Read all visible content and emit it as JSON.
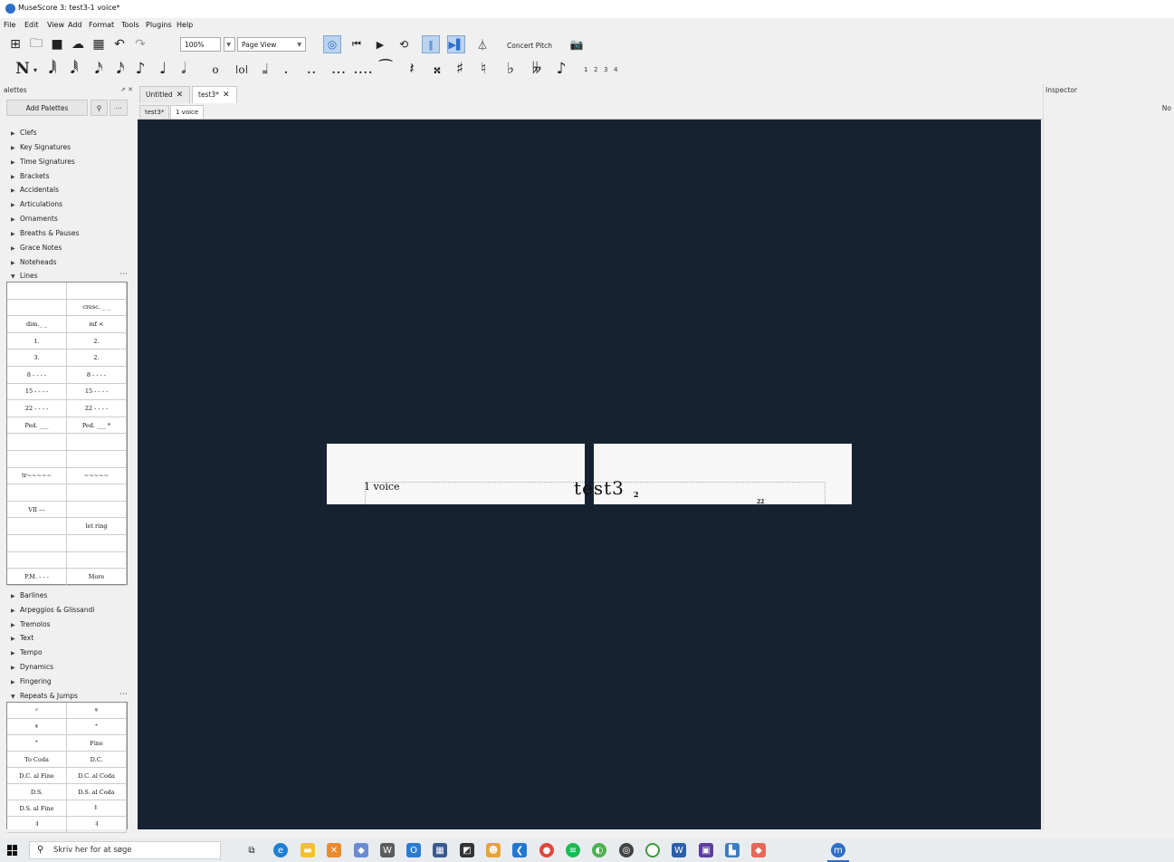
{
  "window": {
    "title": "MuseScore 3: test3-1 voice*"
  },
  "menu": [
    "File",
    "Edit",
    "View",
    "Add",
    "Format",
    "Tools",
    "Plugins",
    "Help"
  ],
  "toolbar": {
    "zoom": "100%",
    "view_mode": "Page View",
    "concert_pitch": "Concert Pitch"
  },
  "note_toolbar": {
    "voices": [
      "1",
      "2",
      "3",
      "4"
    ]
  },
  "palettes": {
    "title": "alettes",
    "add_label": "Add Palettes",
    "categories_top": [
      "Clefs",
      "Key Signatures",
      "Time Signatures",
      "Brackets",
      "Accidentals",
      "Articulations",
      "Ornaments",
      "Breaths & Pauses",
      "Grace Notes",
      "Noteheads"
    ],
    "lines_label": "Lines",
    "lines_cells": [
      "",
      "",
      "",
      "cresc. _ _",
      "dim._ _",
      "mf <",
      "1.",
      "2.",
      "3.",
      "2.",
      "8 - - - -",
      "8 - - - -",
      "15 - - - -",
      "15 - - - -",
      "22 - - - -",
      "22 - - - -",
      "Ped. ___",
      "Ped. ___ *",
      "",
      "",
      "",
      "",
      "tr~~~~~",
      "~~~~~",
      "",
      "",
      "VII ---",
      "",
      "",
      "let ring",
      "",
      "",
      "",
      "",
      "P.M. - - -",
      "More"
    ],
    "categories_mid": [
      "Barlines",
      "Arpeggios & Glissandi",
      "Tremolos",
      "Text",
      "Tempo",
      "Dynamics",
      "Fingering"
    ],
    "repeats_label": "Repeats & Jumps",
    "repeats_cells": [
      "𝄎",
      "𝄋",
      "𝄋",
      "𝄌",
      "𝄌",
      "Fine",
      "To Coda",
      "D.C.",
      "D.C. al Fine",
      "D.C. al Coda",
      "D.S.",
      "D.S. al Coda",
      "D.S. al Fine",
      "𝄆",
      "𝄇",
      "𝄇"
    ]
  },
  "tabs": [
    {
      "label": "Untitled",
      "close": "✕"
    },
    {
      "label": "test3*",
      "close": "✕"
    }
  ],
  "subtabs": [
    "test3*",
    "1 voice"
  ],
  "score": {
    "part_label": "1 voice",
    "title": "test3",
    "superscript": "2",
    "bottom_mark": "22"
  },
  "inspector": {
    "title": "Inspector",
    "no_selection": "No"
  },
  "taskbar": {
    "search_placeholder": "Skriv her for at søge"
  },
  "colors": {
    "canvas": "#162231",
    "accent": "#2d6ec9"
  }
}
